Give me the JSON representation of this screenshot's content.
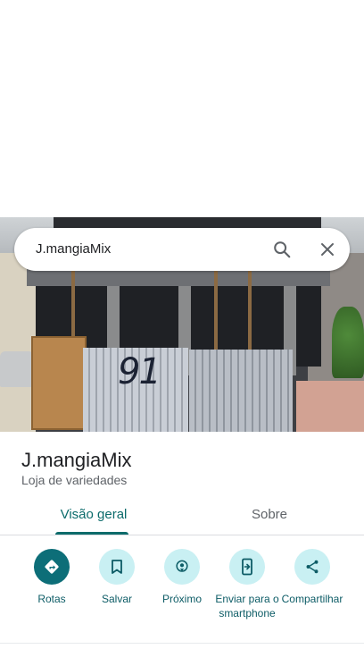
{
  "search": {
    "query": "J.mangiaMix",
    "search_icon": "search-icon",
    "close_icon": "close-icon"
  },
  "photo": {
    "house_number": "91"
  },
  "place": {
    "name": "J.mangiaMix",
    "category": "Loja de variedades"
  },
  "tabs": [
    {
      "label": "Visão geral",
      "selected": true
    },
    {
      "label": "Sobre",
      "selected": false
    }
  ],
  "actions": [
    {
      "label": "Rotas",
      "icon": "directions-icon"
    },
    {
      "label": "Salvar",
      "icon": "bookmark-icon"
    },
    {
      "label": "Próximo",
      "icon": "nearby-icon"
    },
    {
      "label": "Enviar para o smartphone",
      "icon": "send-to-phone-icon"
    },
    {
      "label": "Compartilhar",
      "icon": "share-icon"
    }
  ],
  "colors": {
    "accent": "#0b6b6b",
    "action_bg": "#c9f0f3",
    "primary_action_bg": "#0d6e78"
  }
}
